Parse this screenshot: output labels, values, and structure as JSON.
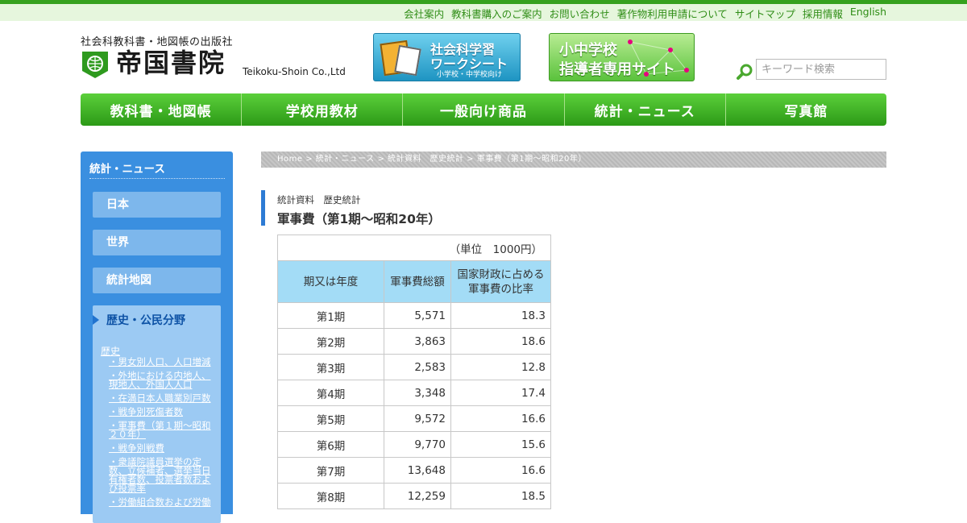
{
  "top_links": [
    "会社案内",
    "教科書購入のご案内",
    "お問い合わせ",
    "著作物利用申請について",
    "サイトマップ",
    "採用情報",
    "English"
  ],
  "logo": {
    "subtitle": "社会科教科書・地図帳の出版社",
    "name": "帝国書院",
    "english": "Teikoku-Shoin Co.,Ltd"
  },
  "banners": {
    "worksheet": {
      "line1": "社会科学習",
      "line2": "ワークシート",
      "line3": "小学校・中学校向け"
    },
    "teachers": {
      "line1": "小中学校",
      "line2": "指導者専用サイト"
    }
  },
  "search": {
    "placeholder": "キーワード検索"
  },
  "global_nav": [
    "教科書・地図帳",
    "学校用教材",
    "一般向け商品",
    "統計・ニュース",
    "写真館"
  ],
  "sidebar": {
    "title": "統計・ニュース",
    "items": [
      "日本",
      "世界",
      "統計地図"
    ],
    "open_item": "歴史・公民分野",
    "category": "歴史",
    "links": [
      "・男女別人口、人口増減",
      "・外地における内地人、現地人、外国人人口",
      "・在満日本人職業別戸数",
      "・戦争別死傷者数",
      "・軍事費（第１期～昭和２０年）",
      "・戦争別戦費",
      "・衆議院議員選挙の定数、立候補者、選挙当日有権者数、投票者数および投票率",
      "・労働組合数および労働"
    ]
  },
  "breadcrumb": "Home > 統計・ニュース > 統計資料　歴史統計 > 軍事費（第1期～昭和20年）",
  "page": {
    "subheading": "統計資料　歴史統計",
    "title": "軍事費（第1期～昭和20年）"
  },
  "table": {
    "unit": "（単位　1000円）",
    "headers": [
      "期又は年度",
      "軍事費総額",
      "国家財政に占める軍事費の比率"
    ],
    "rows": [
      [
        "第1期",
        "5,571",
        "18.3"
      ],
      [
        "第2期",
        "3,863",
        "18.6"
      ],
      [
        "第3期",
        "2,583",
        "12.8"
      ],
      [
        "第4期",
        "3,348",
        "17.4"
      ],
      [
        "第5期",
        "9,572",
        "16.6"
      ],
      [
        "第6期",
        "9,770",
        "15.6"
      ],
      [
        "第7期",
        "13,648",
        "16.6"
      ],
      [
        "第8期",
        "12,259",
        "18.5"
      ]
    ]
  },
  "colors": {
    "brand_green": "#36a11e",
    "sidebar_blue": "#3a8fe0",
    "table_header": "#a3dcf6"
  }
}
